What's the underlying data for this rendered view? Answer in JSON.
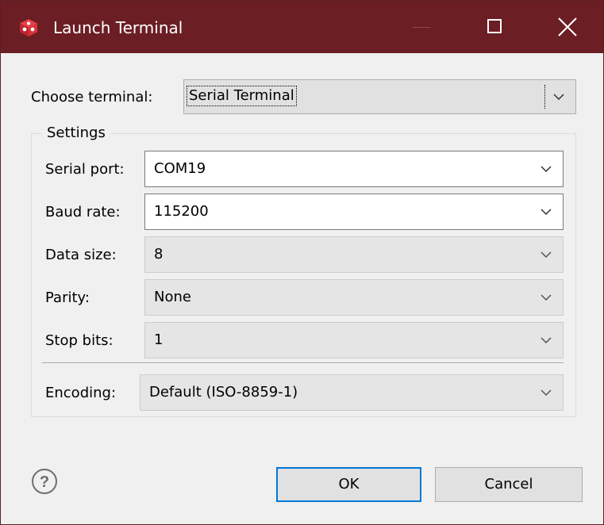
{
  "window": {
    "title": "Launch Terminal",
    "titlebar_color": "#6b1e24",
    "app_icon": "red-cube-icon",
    "controls": [
      "minimize-icon",
      "maximize-icon",
      "close-icon"
    ]
  },
  "terminal": {
    "label": "Choose terminal:",
    "value": "Serial Terminal"
  },
  "settings": {
    "title": "Settings",
    "fields": [
      {
        "label": "Serial port:",
        "value": "COM19",
        "enabled": true
      },
      {
        "label": "Baud rate:",
        "value": "115200",
        "enabled": true
      },
      {
        "label": "Data size:",
        "value": "8",
        "enabled": false
      },
      {
        "label": "Parity:",
        "value": "None",
        "enabled": false
      },
      {
        "label": "Stop bits:",
        "value": "1",
        "enabled": false
      }
    ],
    "encoding": {
      "label": "Encoding:",
      "value": "Default (ISO-8859-1)",
      "enabled": false
    }
  },
  "footer": {
    "help_icon": "help-icon",
    "ok_label": "OK",
    "cancel_label": "Cancel",
    "accent": "#0078d7"
  }
}
